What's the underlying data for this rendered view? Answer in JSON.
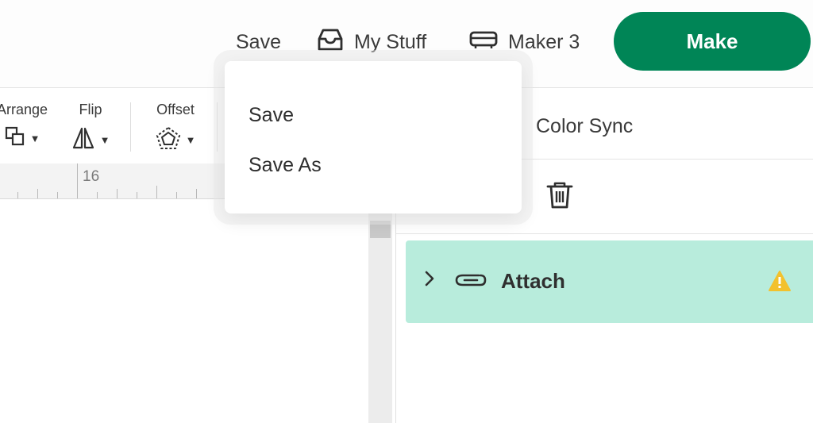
{
  "header": {
    "save_label": "Save",
    "my_stuff_label": "My Stuff",
    "machine_label": "Maker 3",
    "make_label": "Make",
    "icons": {
      "my_stuff": "inbox-tray-icon",
      "machine": "cutting-machine-icon"
    },
    "accent_color": "#008556"
  },
  "toolbar": {
    "arrange_label": "Arrange",
    "flip_label": "Flip",
    "offset_label": "Offset",
    "icons": {
      "arrange": "arrange-layers-icon",
      "flip": "flip-icon",
      "offset": "offset-pentagon-icon"
    }
  },
  "ruler": {
    "visible_mark": "16"
  },
  "layers_panel": {
    "color_sync_label": "Color Sync",
    "delete_icon": "trash-icon",
    "group": {
      "label": "Attach",
      "icons": {
        "expand": "chevron-right-icon",
        "type": "paperclip-icon",
        "status": "warning-icon"
      },
      "highlight_color": "#b8ecdc",
      "warning_color": "#f2c12e"
    }
  },
  "save_menu": {
    "items": [
      {
        "label": "Save"
      },
      {
        "label": "Save As"
      }
    ]
  }
}
